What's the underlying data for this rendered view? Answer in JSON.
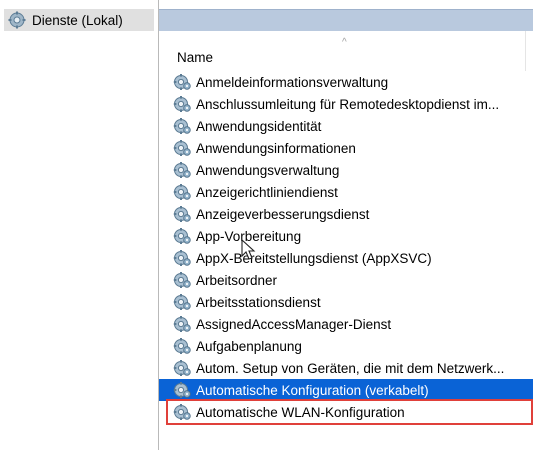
{
  "tree": {
    "root_label": "Dienste (Lokal)",
    "root_icon": "gear-icon"
  },
  "list": {
    "column_name": "Name",
    "sort_indicator": "^",
    "items": [
      {
        "label": "Anmeldeinformationsverwaltung",
        "icon": "service-gear-icon"
      },
      {
        "label": "Anschlussumleitung für Remotedesktopdienst im...",
        "icon": "service-gear-icon"
      },
      {
        "label": "Anwendungsidentität",
        "icon": "service-gear-icon"
      },
      {
        "label": "Anwendungsinformationen",
        "icon": "service-gear-icon"
      },
      {
        "label": "Anwendungsverwaltung",
        "icon": "service-gear-icon"
      },
      {
        "label": "Anzeigerichtliniendienst",
        "icon": "service-gear-icon"
      },
      {
        "label": "Anzeigeverbesserungsdienst",
        "icon": "service-gear-icon"
      },
      {
        "label": "App-Vorbereitung",
        "icon": "service-gear-icon"
      },
      {
        "label": "AppX-Bereitstellungsdienst (AppXSVC)",
        "icon": "service-gear-icon"
      },
      {
        "label": "Arbeitsordner",
        "icon": "service-gear-icon"
      },
      {
        "label": "Arbeitsstationsdienst",
        "icon": "service-gear-icon"
      },
      {
        "label": "AssignedAccessManager-Dienst",
        "icon": "service-gear-icon"
      },
      {
        "label": "Aufgabenplanung",
        "icon": "service-gear-icon"
      },
      {
        "label": "Autom. Setup von Geräten, die mit dem Netzwerk...",
        "icon": "service-gear-icon"
      },
      {
        "label": "Automatische Konfiguration (verkabelt)",
        "icon": "service-gear-icon",
        "selected": true
      },
      {
        "label": "Automatische WLAN-Konfiguration",
        "icon": "service-gear-icon"
      }
    ]
  },
  "colors": {
    "selection": "#0a63d6",
    "highlight_border": "#e0403a",
    "header_band": "#b9c9de",
    "tree_selected": "#e0e0e0"
  },
  "cursor": {
    "icon": "mouse-pointer-icon"
  }
}
